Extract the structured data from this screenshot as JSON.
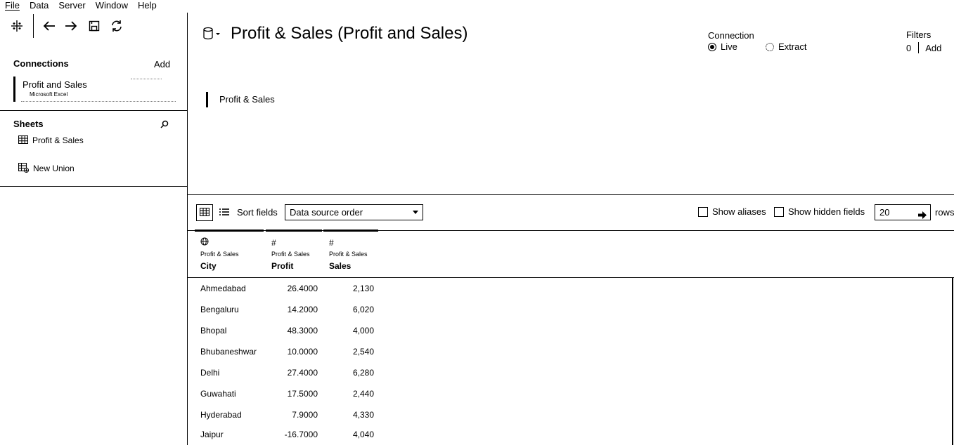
{
  "menu": [
    "File",
    "Data",
    "Server",
    "Window",
    "Help"
  ],
  "icons": {
    "toolbar": [
      "tableau-logo-icon",
      "back-arrow-icon",
      "forward-arrow-icon",
      "save-icon",
      "refresh-icon"
    ]
  },
  "connections": {
    "title": "Connections",
    "add_label": "Add",
    "item_name": "Profit and Sales",
    "item_type": "Microsoft Excel"
  },
  "sheets": {
    "title": "Sheets",
    "items": [
      {
        "label": "Profit & Sales",
        "icon": "table-icon"
      },
      {
        "label": "New Union",
        "icon": "union-icon"
      }
    ]
  },
  "datasource": {
    "title": "Profit & Sales (Profit and Sales)"
  },
  "connection_mode": {
    "label": "Connection",
    "live": "Live",
    "extract": "Extract",
    "selected": "Live"
  },
  "filters": {
    "label": "Filters",
    "count": "0",
    "add_label": "Add"
  },
  "canvas": {
    "table_name": "Profit & Sales"
  },
  "grid_toolbar": {
    "sort_label": "Sort fields",
    "sort_value": "Data source order",
    "show_aliases": "Show aliases",
    "show_hidden": "Show hidden fields",
    "rows_value": "20",
    "rows_label": "rows"
  },
  "columns": [
    {
      "type_icon": "⊕",
      "source": "Profit & Sales",
      "name": "City"
    },
    {
      "type_icon": "#",
      "source": "Profit & Sales",
      "name": "Profit"
    },
    {
      "type_icon": "#",
      "source": "Profit & Sales",
      "name": "Sales"
    }
  ],
  "rows": [
    {
      "city": "Ahmedabad",
      "profit": "26.4000",
      "sales": "2,130"
    },
    {
      "city": "Bengaluru",
      "profit": "14.2000",
      "sales": "6,020"
    },
    {
      "city": "Bhopal",
      "profit": "48.3000",
      "sales": "4,000"
    },
    {
      "city": "Bhubaneshwar",
      "profit": "10.0000",
      "sales": "2,540"
    },
    {
      "city": "Delhi",
      "profit": "27.4000",
      "sales": "6,280"
    },
    {
      "city": "Guwahati",
      "profit": "17.5000",
      "sales": "2,440"
    },
    {
      "city": "Hyderabad",
      "profit": "7.9000",
      "sales": "4,330"
    },
    {
      "city": "Jaipur",
      "profit": "-16.7000",
      "sales": "4,040"
    }
  ]
}
